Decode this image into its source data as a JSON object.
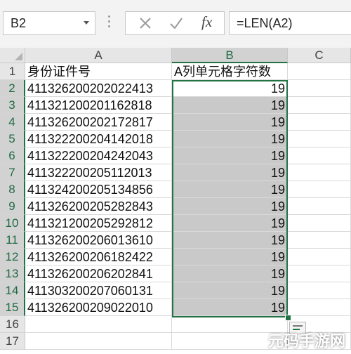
{
  "formula_bar": {
    "name_box": "B2",
    "formula": "=LEN(A2)",
    "fx_label": "fx"
  },
  "columns": [
    {
      "label": ""
    },
    {
      "label": "A"
    },
    {
      "label": "B"
    },
    {
      "label": "C"
    }
  ],
  "rows": [
    "1",
    "2",
    "3",
    "4",
    "5",
    "6",
    "7",
    "8",
    "9",
    "10",
    "11",
    "12",
    "13",
    "14",
    "15",
    "16",
    "17"
  ],
  "cells": {
    "A1": "身份证件号",
    "B1": "A列单元格字符数",
    "A": [
      "411326200202022413",
      "411321200201162818",
      "411326200202172817",
      "411322200204142018",
      "411322200204242043",
      "411322200205112013",
      "411324200205134856",
      "411326200205282843",
      "411321200205292812",
      "411326200206013610",
      "411326200206182422",
      "411326200206202841",
      "411303200207060131",
      "411326200209022010"
    ],
    "B": [
      "19",
      "19",
      "19",
      "19",
      "19",
      "19",
      "19",
      "19",
      "19",
      "19",
      "19",
      "19",
      "19",
      "19"
    ]
  },
  "colors": {
    "accent": "#217346",
    "selection_fill": "#c9c9c9"
  },
  "watermark": "元码手游网"
}
